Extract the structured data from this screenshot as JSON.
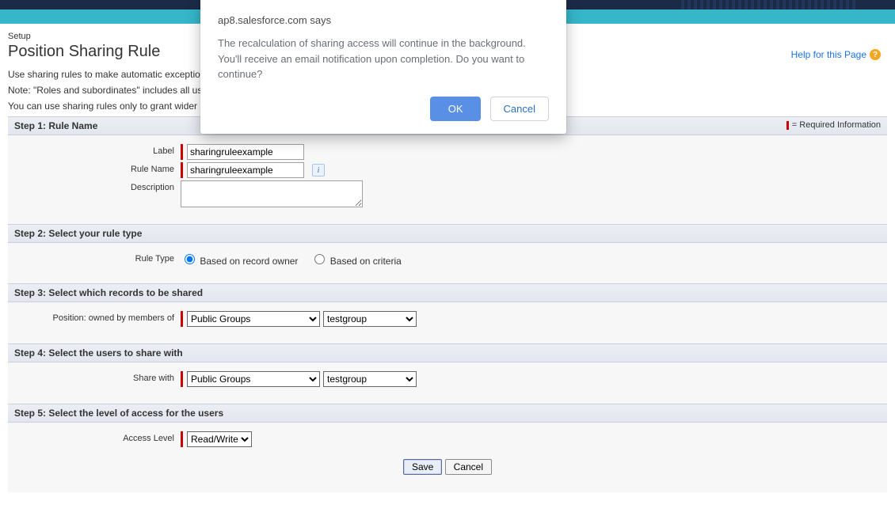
{
  "dialog": {
    "origin": "ap8.salesforce.com says",
    "message": "The recalculation of sharing access will continue in the background. You'll receive an email notification upon completion. Do you want to continue?",
    "ok": "OK",
    "cancel": "Cancel"
  },
  "header": {
    "breadcrumb": "Setup",
    "title": "Position Sharing Rule",
    "help_link": "Help for this Page"
  },
  "intro": {
    "p1": "Use sharing rules to make automatic exception",
    "p2": "Note: \"Roles and subordinates\" includes all us",
    "p3": "You can use sharing rules only to grant wider a"
  },
  "required_legend": "= Required Information",
  "step1": {
    "title": "Step 1: Rule Name",
    "label_label": "Label",
    "rulename_label": "Rule Name",
    "description_label": "Description",
    "label_value": "sharingruleexample",
    "rulename_value": "sharingruleexample",
    "description_value": ""
  },
  "step2": {
    "title": "Step 2: Select your rule type",
    "ruletype_label": "Rule Type",
    "opt_owner": "Based on record owner",
    "opt_criteria": "Based on criteria"
  },
  "step3": {
    "title": "Step 3: Select which records to be shared",
    "owned_label": "Position: owned by members of",
    "group_type": "Public Groups",
    "group_value": "testgroup"
  },
  "step4": {
    "title": "Step 4: Select the users to share with",
    "share_label": "Share with",
    "group_type": "Public Groups",
    "group_value": "testgroup"
  },
  "step5": {
    "title": "Step 5: Select the level of access for the users",
    "access_label": "Access Level",
    "access_value": "Read/Write"
  },
  "buttons": {
    "save": "Save",
    "cancel": "Cancel"
  }
}
